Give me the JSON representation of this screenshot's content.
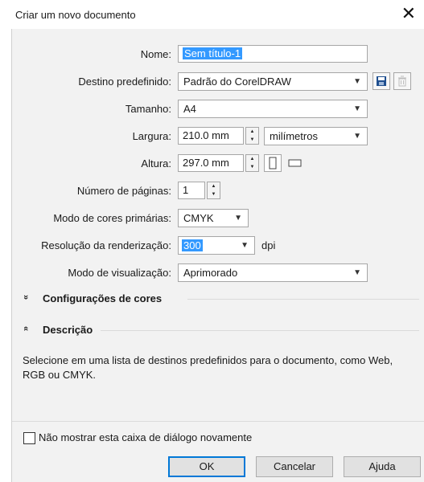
{
  "dialog": {
    "title": "Criar um novo documento",
    "close_glyph": "✕"
  },
  "form": {
    "name_label": "Nome:",
    "name_value": "Sem título-1",
    "preset_label": "Destino predefinido:",
    "preset_value": "Padrão do CorelDRAW",
    "size_label": "Tamanho:",
    "size_value": "A4",
    "width_label": "Largura:",
    "width_value": "210.0 mm",
    "units_value": "milímetros",
    "height_label": "Altura:",
    "height_value": "297.0 mm",
    "pages_label": "Número de páginas:",
    "pages_value": "1",
    "color_mode_label": "Modo de cores primárias:",
    "color_mode_value": "CMYK",
    "resolution_label": "Resolução da renderização:",
    "resolution_value": "300",
    "resolution_unit": "dpi",
    "preview_label": "Modo de visualização:",
    "preview_value": "Aprimorado"
  },
  "sections": {
    "color_settings": "Configurações de cores",
    "description": "Descrição",
    "collapsed_glyph": "»",
    "expanded_glyph": "«"
  },
  "description_text": "Selecione em uma lista de destinos predefinidos para o documento, como Web, RGB ou CMYK.",
  "footer": {
    "dont_show_label": "Não mostrar esta caixa de diálogo novamente",
    "ok_label": "OK",
    "cancel_label": "Cancelar",
    "help_label": "Ajuda"
  },
  "icons": {
    "save_preset": "save-icon",
    "delete_preset": "trash-icon",
    "portrait": "portrait-page-icon",
    "landscape": "landscape-page-icon"
  },
  "colors": {
    "selection": "#3399ff",
    "save_icon": "#1f4f8f",
    "default_button_border": "#0078d7"
  }
}
